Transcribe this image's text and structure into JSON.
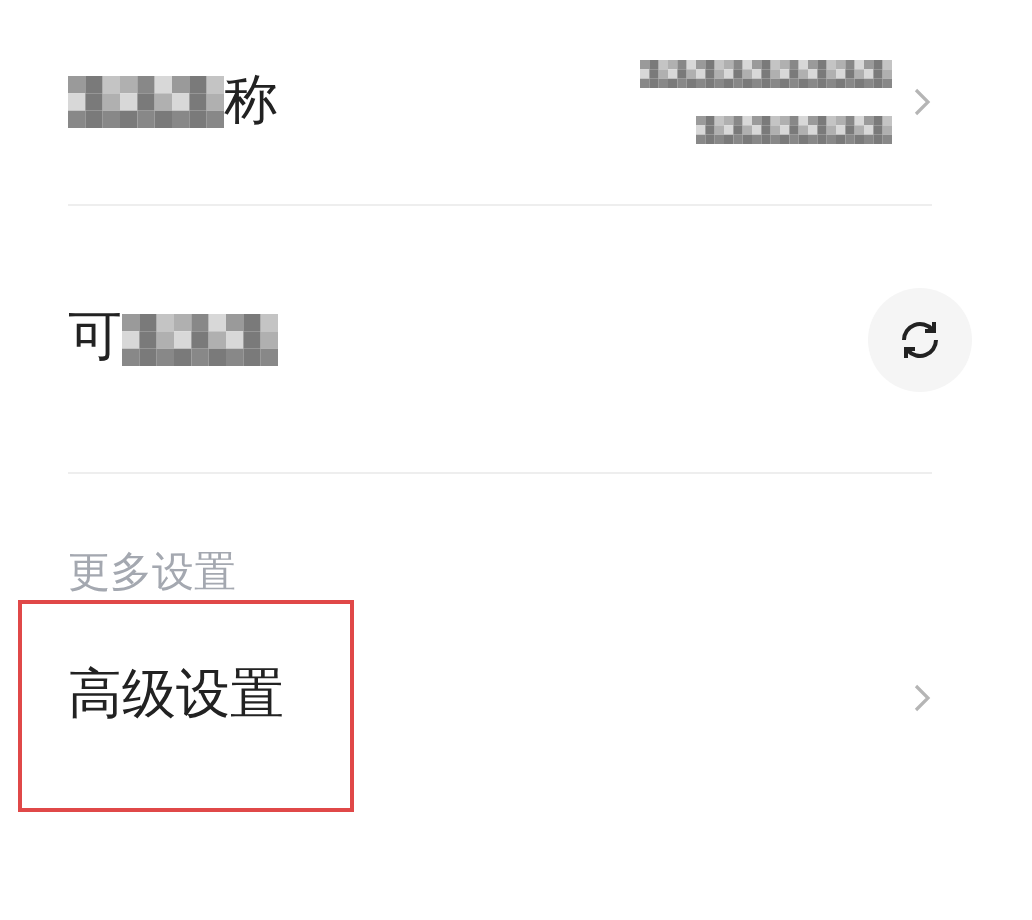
{
  "rows": [
    {
      "kind": "value",
      "label_parts": [
        {
          "kind": "mosaic"
        },
        {
          "kind": "text",
          "text": "称"
        }
      ],
      "value_lines": [
        {
          "kind": "mosaic-wide"
        },
        {
          "kind": "mosaic-medium"
        }
      ]
    },
    {
      "kind": "refresh",
      "label_parts": [
        {
          "kind": "text",
          "text": "可"
        },
        {
          "kind": "mosaic"
        }
      ]
    }
  ],
  "section": {
    "title": "更多设置"
  },
  "items": [
    {
      "label": "高级设置",
      "highlighted": true
    }
  ]
}
